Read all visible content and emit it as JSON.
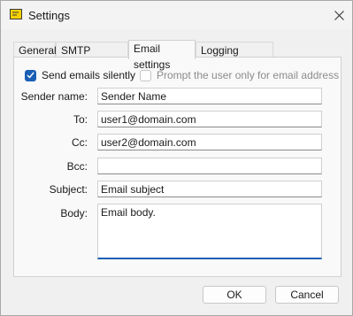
{
  "window": {
    "title": "Settings"
  },
  "tabs": [
    {
      "label": "General"
    },
    {
      "label": "SMTP settings"
    },
    {
      "label": "Email settings"
    },
    {
      "label": "Logging settings"
    }
  ],
  "checkboxes": {
    "send_silently": {
      "label": "Send emails silently",
      "checked": true
    },
    "prompt_address": {
      "label": "Prompt the user only for email address",
      "checked": false,
      "enabled": false
    }
  },
  "form": {
    "sender_name": {
      "label": "Sender name:",
      "value": "Sender Name"
    },
    "to": {
      "label": "To:",
      "value": "user1@domain.com"
    },
    "cc": {
      "label": "Cc:",
      "value": "user2@domain.com"
    },
    "bcc": {
      "label": "Bcc:",
      "value": ""
    },
    "subject": {
      "label": "Subject:",
      "value": "Email subject"
    },
    "body": {
      "label": "Body:",
      "value": "Email body."
    }
  },
  "buttons": {
    "ok": "OK",
    "cancel": "Cancel"
  },
  "colors": {
    "accent": "#1a5fb4",
    "title_icon": "#f5d000"
  }
}
